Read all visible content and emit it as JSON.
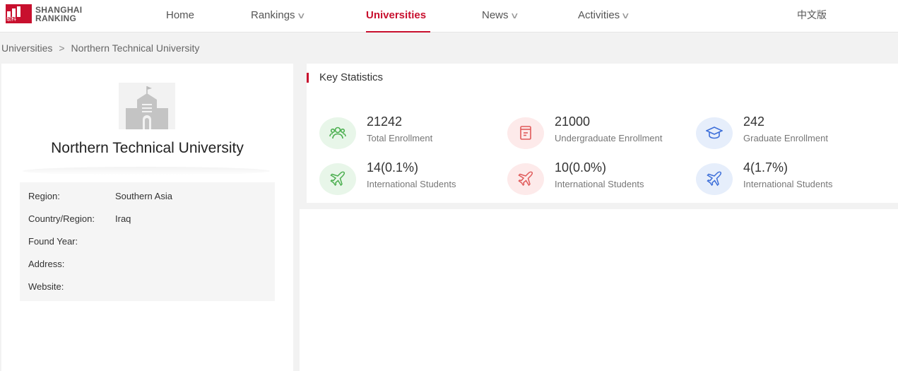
{
  "brand": {
    "line1": "SHANGHAI",
    "line2": "RANKING",
    "mark_text": "软科",
    "color": "#c8102e"
  },
  "nav": {
    "home": "Home",
    "rankings": "Rankings",
    "universities": "Universities",
    "news": "News",
    "activities": "Activities",
    "language": "中文版"
  },
  "breadcrumb": {
    "root": "Universities",
    "current": "Northern Technical University"
  },
  "university": {
    "name": "Northern Technical University",
    "info": [
      {
        "label": "Region:",
        "value": "Southern Asia"
      },
      {
        "label": "Country/Region:",
        "value": "Iraq"
      },
      {
        "label": "Found Year:",
        "value": ""
      },
      {
        "label": "Address:",
        "value": ""
      },
      {
        "label": "Website:",
        "value": ""
      }
    ]
  },
  "stats": {
    "title": "Key Statistics",
    "items": [
      {
        "value": "21242",
        "label": "Total Enrollment",
        "icon": "users-icon",
        "color": "#4caf50",
        "bg": "#e8f6e9"
      },
      {
        "value": "21000",
        "label": "Undergraduate Enrollment",
        "icon": "book-icon",
        "color": "#e05a5a",
        "bg": "#fdeaea"
      },
      {
        "value": "242",
        "label": "Graduate Enrollment",
        "icon": "graduation-cap-icon",
        "color": "#3d6fd9",
        "bg": "#e6eefb"
      },
      {
        "value": "14(0.1%)",
        "label": "International Students",
        "icon": "plane-icon",
        "color": "#4caf50",
        "bg": "#e8f6e9"
      },
      {
        "value": "10(0.0%)",
        "label": "International Students",
        "icon": "plane-icon",
        "color": "#e05a5a",
        "bg": "#fdeaea"
      },
      {
        "value": "4(1.7%)",
        "label": "International Students",
        "icon": "plane-icon",
        "color": "#3d6fd9",
        "bg": "#e6eefb"
      }
    ]
  }
}
